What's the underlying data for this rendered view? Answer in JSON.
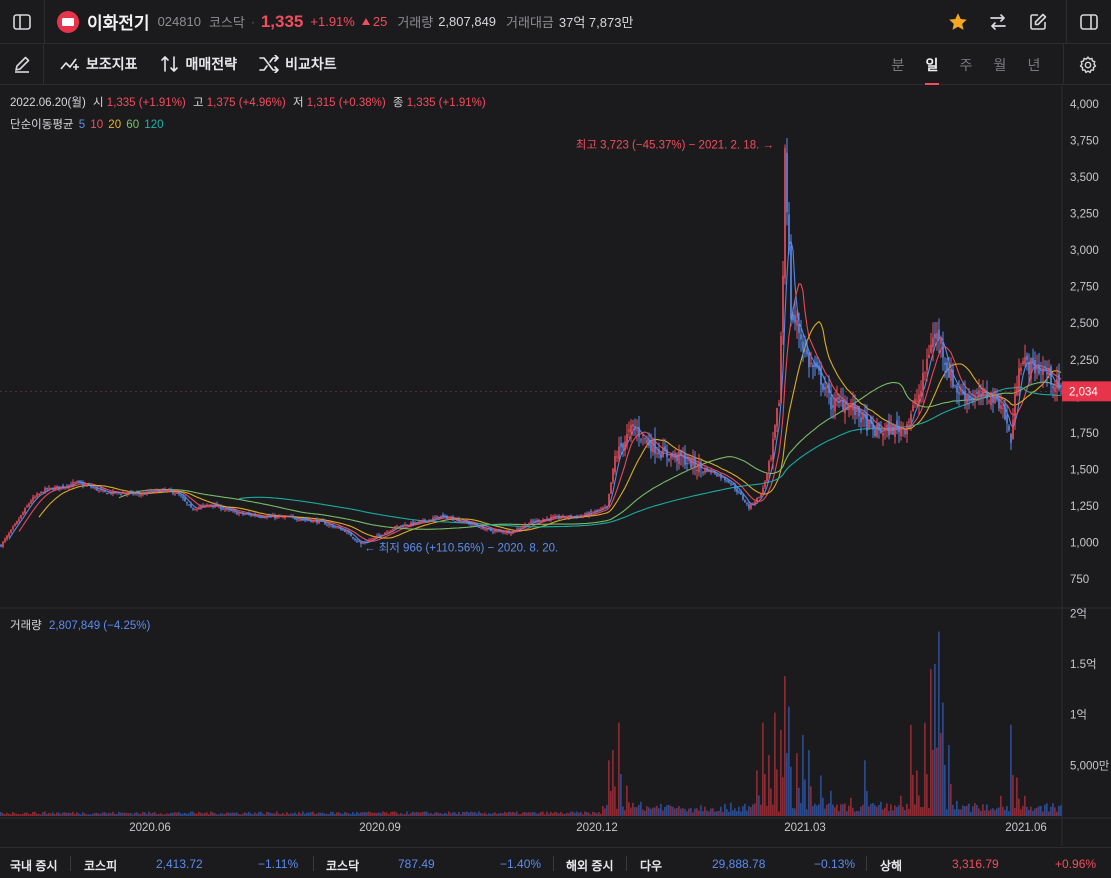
{
  "header": {
    "stock_name": "이화전기",
    "stock_code": "024810",
    "market": "코스닥",
    "price": "1,335",
    "change_pct": "+1.91%",
    "change_abs": "25",
    "volume_label": "거래량",
    "volume_value": "2,807,849",
    "amount_label": "거래대금",
    "amount_value": "37억 7,873만",
    "icons": [
      "sidebar-toggle-icon",
      "star-icon",
      "swap-icon",
      "edit-icon",
      "panel-toggle-icon"
    ],
    "colors": {
      "up": "#f24d5c",
      "down": "#5b8def",
      "star": "#f5a623"
    }
  },
  "toolbar": {
    "items": [
      {
        "label": "보조지표",
        "icon": "indicator-icon"
      },
      {
        "label": "매매전략",
        "icon": "strategy-icon"
      },
      {
        "label": "비교차트",
        "icon": "compare-icon"
      }
    ],
    "periods": [
      "분",
      "일",
      "주",
      "월",
      "년"
    ],
    "active_period": "일"
  },
  "legend": {
    "date": "2022.06.20(월)",
    "open_label": "시",
    "open": "1,335 (+1.91%)",
    "high_label": "고",
    "high": "1,375 (+4.96%)",
    "low_label": "저",
    "low": "1,315 (+0.38%)",
    "close_label": "종",
    "close": "1,335 (+1.91%)",
    "ma_title": "단순이동평균",
    "ma_periods": [
      "5",
      "10",
      "20",
      "60",
      "120"
    ],
    "ma_colors": [
      "#5b8def",
      "#f24d5c",
      "#e6b422",
      "#7cc36a",
      "#19b3a8"
    ],
    "volume_label": "거래량",
    "volume_value": "2,807,849 (−4.25%)"
  },
  "chart_data": {
    "type": "candlestick",
    "annotations": {
      "high": "최고 3,723 (−45.37%) − 2021. 2. 18.",
      "low": "최저 966 (+110.56%) − 2020. 8. 20.",
      "current_price": "2,034"
    },
    "price_axis_ticks": [
      4000,
      3750,
      3500,
      3250,
      3000,
      2750,
      2500,
      2250,
      2000,
      1750,
      1500,
      1250,
      1000,
      750
    ],
    "price_axis_labels": [
      "4,000",
      "3,750",
      "3,500",
      "3,250",
      "3,000",
      "2,750",
      "2,500",
      "2,250",
      "2,000",
      "1,750",
      "1,500",
      "1,250",
      "1,000",
      "750"
    ],
    "volume_axis_labels": [
      "2억",
      "1.5억",
      "1억",
      "5,000만"
    ],
    "volume_axis_values": [
      200000000,
      150000000,
      100000000,
      50000000
    ],
    "x_axis_labels": [
      "2020.06",
      "2020.09",
      "2020.12",
      "2021.03",
      "2021.06"
    ],
    "price_range": [
      700,
      4050
    ],
    "volume_max": 210000000,
    "price_path": [
      [
        0,
        980
      ],
      [
        8,
        1140
      ],
      [
        15,
        1290
      ],
      [
        22,
        1360
      ],
      [
        30,
        1380
      ],
      [
        38,
        1410
      ],
      [
        45,
        1380
      ],
      [
        52,
        1340
      ],
      [
        60,
        1340
      ],
      [
        70,
        1330
      ],
      [
        80,
        1360
      ],
      [
        88,
        1340
      ],
      [
        95,
        1230
      ],
      [
        105,
        1260
      ],
      [
        118,
        1200
      ],
      [
        130,
        1180
      ],
      [
        145,
        1170
      ],
      [
        160,
        1140
      ],
      [
        172,
        1080
      ],
      [
        180,
        990
      ],
      [
        188,
        1040
      ],
      [
        198,
        1110
      ],
      [
        210,
        1140
      ],
      [
        220,
        1180
      ],
      [
        232,
        1140
      ],
      [
        245,
        1080
      ],
      [
        255,
        1070
      ],
      [
        265,
        1140
      ],
      [
        275,
        1170
      ],
      [
        290,
        1180
      ],
      [
        303,
        1240
      ],
      [
        307,
        1580
      ],
      [
        312,
        1700
      ],
      [
        316,
        1790
      ],
      [
        324,
        1680
      ],
      [
        332,
        1600
      ],
      [
        340,
        1580
      ],
      [
        348,
        1520
      ],
      [
        356,
        1480
      ],
      [
        364,
        1420
      ],
      [
        370,
        1320
      ],
      [
        374,
        1240
      ],
      [
        380,
        1330
      ],
      [
        385,
        1560
      ],
      [
        389,
        1980
      ],
      [
        391,
        2840
      ],
      [
        392,
        3723
      ],
      [
        395,
        2560
      ],
      [
        399,
        2450
      ],
      [
        404,
        2230
      ],
      [
        410,
        2120
      ],
      [
        415,
        1950
      ],
      [
        422,
        1960
      ],
      [
        430,
        1860
      ],
      [
        436,
        1760
      ],
      [
        444,
        1770
      ],
      [
        452,
        1790
      ],
      [
        460,
        2040
      ],
      [
        465,
        2380
      ],
      [
        469,
        2420
      ],
      [
        473,
        2200
      ],
      [
        478,
        2040
      ],
      [
        486,
        1990
      ],
      [
        494,
        2010
      ],
      [
        500,
        1960
      ],
      [
        505,
        1700
      ],
      [
        509,
        2250
      ],
      [
        514,
        2210
      ],
      [
        522,
        2180
      ],
      [
        526,
        2100
      ],
      [
        530,
        2034
      ]
    ],
    "volume_spikes": [
      [
        304,
        55
      ],
      [
        306,
        65
      ],
      [
        309,
        92
      ],
      [
        313,
        30
      ],
      [
        320,
        14
      ],
      [
        330,
        12
      ],
      [
        345,
        8
      ],
      [
        360,
        9
      ],
      [
        372,
        12
      ],
      [
        378,
        45
      ],
      [
        381,
        92
      ],
      [
        384,
        60
      ],
      [
        387,
        102
      ],
      [
        390,
        85
      ],
      [
        392,
        138
      ],
      [
        394,
        108
      ],
      [
        398,
        62
      ],
      [
        401,
        80
      ],
      [
        404,
        65
      ],
      [
        410,
        40
      ],
      [
        415,
        25
      ],
      [
        425,
        18
      ],
      [
        432,
        55
      ],
      [
        440,
        14
      ],
      [
        450,
        20
      ],
      [
        455,
        90
      ],
      [
        458,
        45
      ],
      [
        462,
        92
      ],
      [
        465,
        145
      ],
      [
        467,
        150
      ],
      [
        469,
        182
      ],
      [
        471,
        112
      ],
      [
        474,
        70
      ],
      [
        478,
        15
      ],
      [
        500,
        20
      ],
      [
        505,
        90
      ],
      [
        508,
        38
      ],
      [
        512,
        20
      ],
      [
        520,
        10
      ]
    ]
  },
  "footer": {
    "domestic_label": "국내 증시",
    "kospi_label": "코스피",
    "kospi_value": "2,413.72",
    "kospi_change": "−1.11%",
    "kosdaq_label": "코스닥",
    "kosdaq_value": "787.49",
    "kosdaq_change": "−1.40%",
    "overseas_label": "해외 증시",
    "dow_label": "다우",
    "dow_value": "29,888.78",
    "dow_change": "−0.13%",
    "shanghai_label": "상해",
    "shanghai_value": "3,316.79",
    "shanghai_change": "+0.96%"
  }
}
